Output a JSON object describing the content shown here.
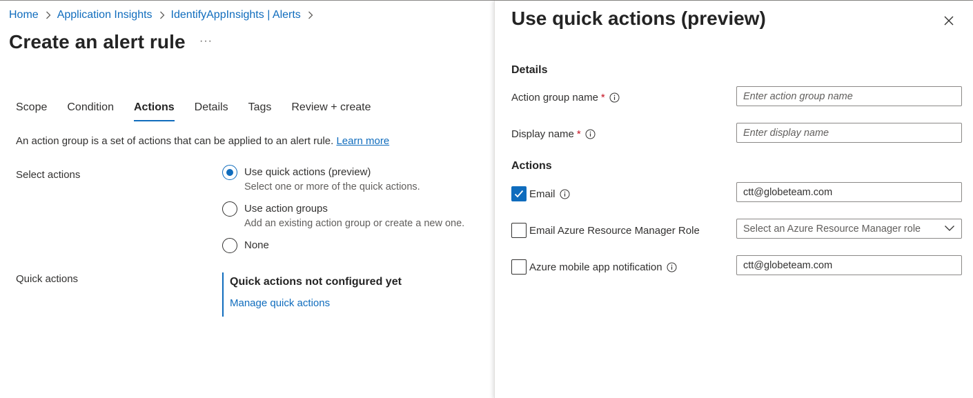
{
  "breadcrumb": [
    {
      "label": "Home"
    },
    {
      "label": "Application Insights"
    },
    {
      "label": "IdentifyAppInsights | Alerts"
    }
  ],
  "page": {
    "title": "Create an alert rule",
    "more": "···"
  },
  "tabs": [
    {
      "label": "Scope"
    },
    {
      "label": "Condition"
    },
    {
      "label": "Actions",
      "active": true
    },
    {
      "label": "Details"
    },
    {
      "label": "Tags"
    },
    {
      "label": "Review + create"
    }
  ],
  "intro": {
    "text": "An action group is a set of actions that can be applied to an alert rule.",
    "link": "Learn more"
  },
  "select_actions": {
    "label": "Select actions",
    "options": [
      {
        "label": "Use quick actions (preview)",
        "desc": "Select one or more of the quick actions.",
        "checked": true
      },
      {
        "label": "Use action groups",
        "desc": "Add an existing action group or create a new one.",
        "checked": false
      },
      {
        "label": "None",
        "checked": false
      }
    ]
  },
  "quick_actions": {
    "label": "Quick actions",
    "status": "Quick actions not configured yet",
    "link": "Manage quick actions"
  },
  "panel": {
    "title": "Use quick actions (preview)",
    "details_heading": "Details",
    "action_group_name": {
      "label": "Action group name",
      "required": "*",
      "placeholder": "Enter action group name"
    },
    "display_name": {
      "label": "Display name",
      "required": "*",
      "placeholder": "Enter display name"
    },
    "actions_heading": "Actions",
    "email": {
      "label": "Email",
      "checked": true,
      "value": "ctt@globeteam.com"
    },
    "email_arm_role": {
      "label": "Email Azure Resource Manager Role",
      "checked": false,
      "placeholder": "Select an Azure Resource Manager role"
    },
    "mobile_app": {
      "label": "Azure mobile app notification",
      "checked": false,
      "value": "ctt@globeteam.com"
    }
  },
  "colors": {
    "accent": "#0f6cbd",
    "required": "#c50f1f"
  }
}
